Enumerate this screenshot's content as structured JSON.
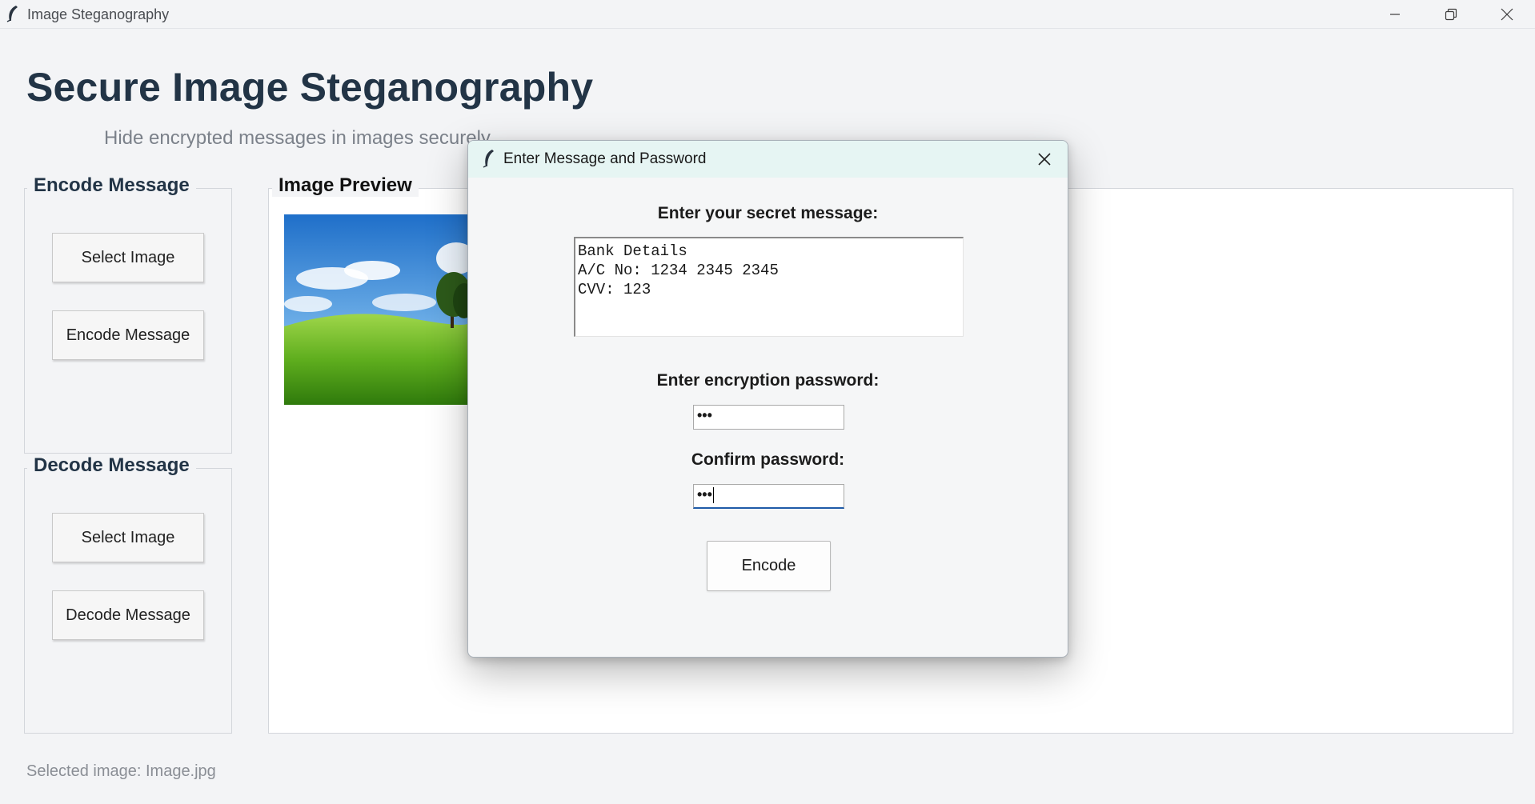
{
  "window": {
    "title": "Image Steganography"
  },
  "header": {
    "title": "Secure Image Steganography",
    "subtitle": "Hide encrypted messages in images securely"
  },
  "encode_panel": {
    "title": "Encode Message",
    "select_image_label": "Select Image",
    "encode_message_label": "Encode Message"
  },
  "decode_panel": {
    "title": "Decode Message",
    "select_image_label": "Select Image",
    "decode_message_label": "Decode Message"
  },
  "preview_panel": {
    "title": "Image Preview"
  },
  "status": {
    "text": "Selected image: Image.jpg"
  },
  "dialog": {
    "title": "Enter Message and Password",
    "message_label": "Enter your secret message:",
    "message_value": "Bank Details\nA/C No: 1234 2345 2345\nCVV: 123",
    "password_label": "Enter encryption password:",
    "password_value": "•••",
    "confirm_label": "Confirm password:",
    "confirm_value": "•••",
    "encode_label": "Encode"
  },
  "icons": {
    "app": "feather-icon",
    "minimize": "minimize-icon",
    "maximize": "restore-icon",
    "close": "close-icon"
  },
  "colors": {
    "title_text": "#223446",
    "dialog_titlebar": "#e6f5f3",
    "focus_accent": "#1f5ba8"
  }
}
